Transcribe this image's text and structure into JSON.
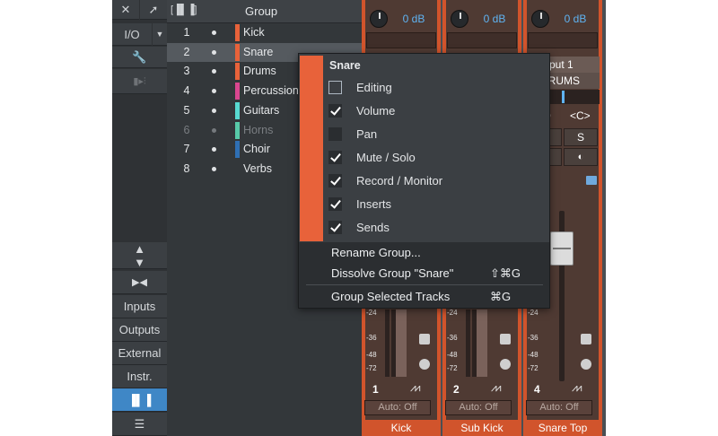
{
  "toolbar": {
    "io_label": "I/O",
    "buttons": [
      "Inputs",
      "Outputs",
      "External",
      "Instr."
    ]
  },
  "group_list": {
    "header": "Group",
    "rows": [
      {
        "num": "1",
        "name": "Kick",
        "color": "#e8623a"
      },
      {
        "num": "2",
        "name": "Snare",
        "color": "#e8623a"
      },
      {
        "num": "3",
        "name": "Drums",
        "color": "#e8623a"
      },
      {
        "num": "4",
        "name": "Percussion",
        "color": "#d9468f"
      },
      {
        "num": "5",
        "name": "Guitars",
        "color": "#57d9d0"
      },
      {
        "num": "6",
        "name": "Horns",
        "color": "#57c9a8"
      },
      {
        "num": "7",
        "name": "Choir",
        "color": "#2f6fb3"
      },
      {
        "num": "8",
        "name": "Verbs",
        "color": ""
      }
    ]
  },
  "channels": [
    {
      "db": "0 dB",
      "num": "1",
      "automation": "Auto: Off",
      "name": "Kick"
    },
    {
      "db": "0 dB",
      "num": "2",
      "automation": "Auto: Off",
      "name": "Sub Kick"
    },
    {
      "db": "0 dB",
      "num": "4",
      "automation": "Auto: Off",
      "name": "Snare Top",
      "input": "Input 1",
      "bus": "DRUMS",
      "pan": "0",
      "pan_center": "<C>",
      "solo": "S"
    }
  ],
  "meter_ticks": [
    "-24",
    "-36",
    "-48",
    "-72"
  ],
  "context_menu": {
    "title": "Snare",
    "options": [
      {
        "label": "Editing",
        "checked": false,
        "outline": true
      },
      {
        "label": "Volume",
        "checked": true
      },
      {
        "label": "Pan",
        "checked": false
      },
      {
        "label": "Mute / Solo",
        "checked": true
      },
      {
        "label": "Record / Monitor",
        "checked": true
      },
      {
        "label": "Inserts",
        "checked": true
      },
      {
        "label": "Sends",
        "checked": true
      }
    ],
    "actions": [
      {
        "label": "Rename Group...",
        "shortcut": ""
      },
      {
        "label": "Dissolve Group \"Snare\"",
        "shortcut": "⇧⌘G"
      },
      {
        "label": "Group Selected Tracks",
        "shortcut": "⌘G"
      }
    ]
  },
  "colors": {
    "accent": "#3f87c6",
    "group_orange": "#e8623a",
    "strip_orange": "#d1542c"
  }
}
